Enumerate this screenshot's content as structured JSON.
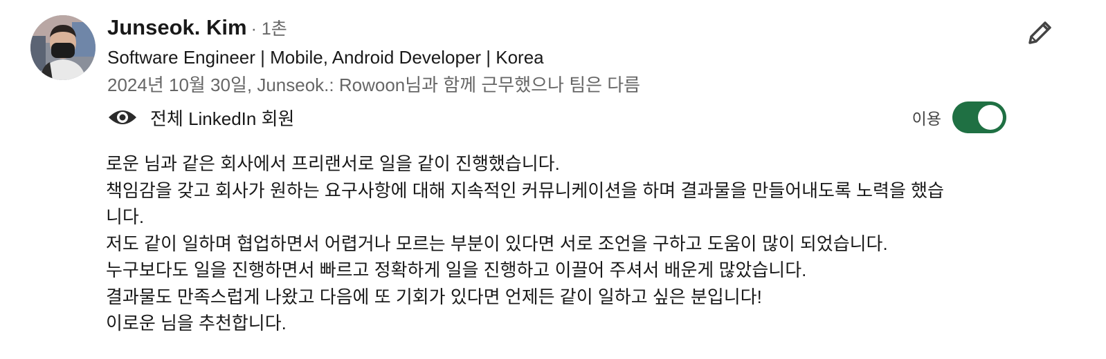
{
  "profile": {
    "name": "Junseok. Kim",
    "degree": "· 1촌",
    "headline": "Software Engineer | Mobile, Android Developer | Korea",
    "relation": "2024년 10월 30일, Junseok.: Rowoon님과 함께 근무했으나 팀은 다름"
  },
  "visibility": {
    "label": "전체 LinkedIn 회원",
    "icon": "eye-icon"
  },
  "toggle": {
    "label": "이용",
    "state": "on",
    "color": "#1f7043"
  },
  "actions": {
    "edit_icon": "pencil-icon"
  },
  "recommendation": {
    "lines": [
      "로운 님과 같은 회사에서 프리랜서로 일을 같이 진행했습니다.",
      "책임감을 갖고 회사가 원하는 요구사항에 대해 지속적인 커뮤니케이션을 하며 결과물을 만들어내도록 노력을 했습",
      "니다.",
      "저도 같이 일하며 협업하면서 어렵거나 모르는 부분이 있다면 서로 조언을 구하고 도움이 많이 되었습니다.",
      "누구보다도 일을 진행하면서 빠르고 정확하게 일을 진행하고 이끌어 주셔서 배운게 많았습니다.",
      "결과물도 만족스럽게 나왔고 다음에 또 기회가 있다면 언제든 같이 일하고 싶은 분입니다!",
      "이로운 님을 추천합니다."
    ]
  },
  "colors": {
    "text_primary": "#191919",
    "text_secondary": "#666666",
    "accent_green": "#1f7043"
  }
}
